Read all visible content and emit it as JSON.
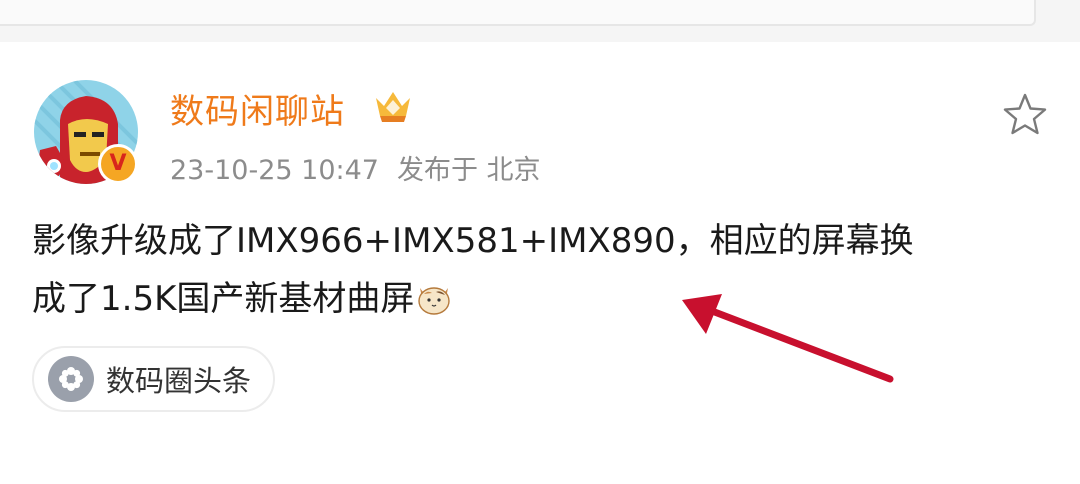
{
  "post": {
    "username": "数码闲聊站",
    "timestamp": "23-10-25 10:47",
    "location": "发布于 北京",
    "content_line1": "影像升级成了IMX966+IMX581+IMX890，相应的屏幕换",
    "content_line2": "成了1.5K国产新基材曲屏",
    "verified_badge": "V",
    "icons": {
      "vip": "vip-crown-icon",
      "favorite": "star-icon",
      "emoji": "cat-emoji-icon",
      "topic": "flower-icon"
    }
  },
  "topic": {
    "label": "数码圈头条"
  },
  "colors": {
    "username": "#ef7a1a",
    "meta_text": "#8c8c8c",
    "arrow": "#c8102e",
    "badge": "#f5a623"
  }
}
